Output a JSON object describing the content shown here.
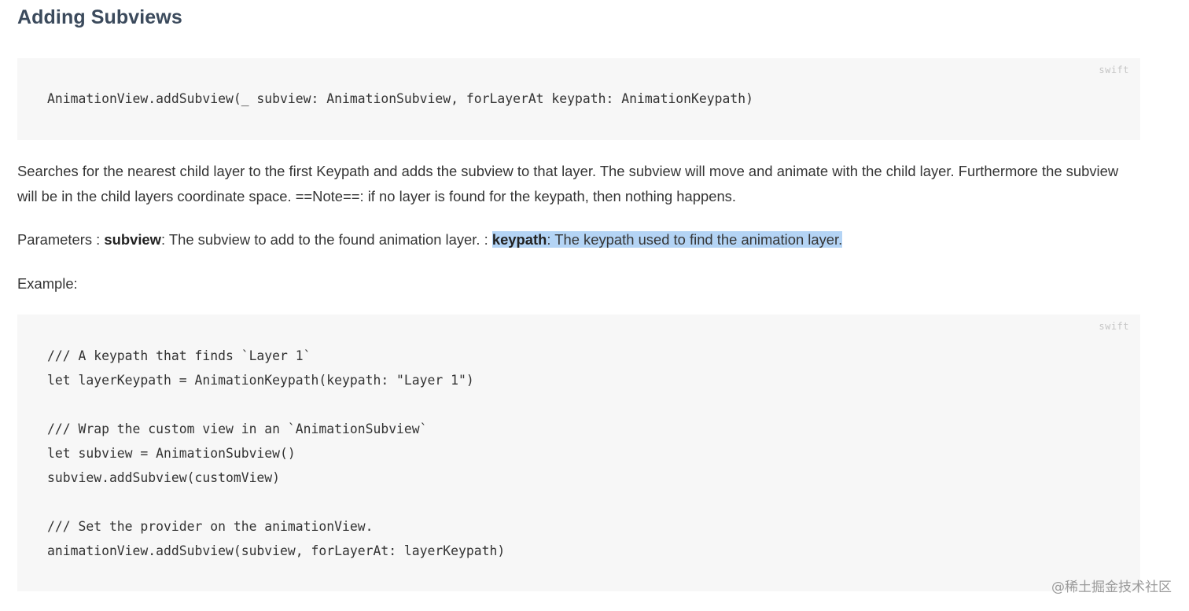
{
  "heading": "Adding Subviews",
  "code_block_1": {
    "language": "swift",
    "code": "AnimationView.addSubview(_ subview: AnimationSubview, forLayerAt keypath: AnimationKeypath)"
  },
  "description": "Searches for the nearest child layer to the first Keypath and adds the subview to that layer. The subview will move and animate with the child layer. Furthermore the subview will be in the child layers coordinate space. ==Note==: if no layer is found for the keypath, then nothing happens.",
  "parameters": {
    "prefix": "Parameters : ",
    "subview_name": "subview",
    "subview_desc": ": The subview to add to the found animation layer. : ",
    "keypath_name": "keypath",
    "keypath_desc": ": The keypath used to find the animation layer."
  },
  "example_label": "Example:",
  "code_block_2": {
    "language": "swift",
    "code": "/// A keypath that finds `Layer 1`\nlet layerKeypath = AnimationKeypath(keypath: \"Layer 1\")\n\n/// Wrap the custom view in an `AnimationSubview`\nlet subview = AnimationSubview()\nsubview.addSubview(customView)\n\n/// Set the provider on the animationView.\nanimationView.addSubview(subview, forLayerAt: layerKeypath)"
  },
  "watermark": "@稀土掘金技术社区"
}
